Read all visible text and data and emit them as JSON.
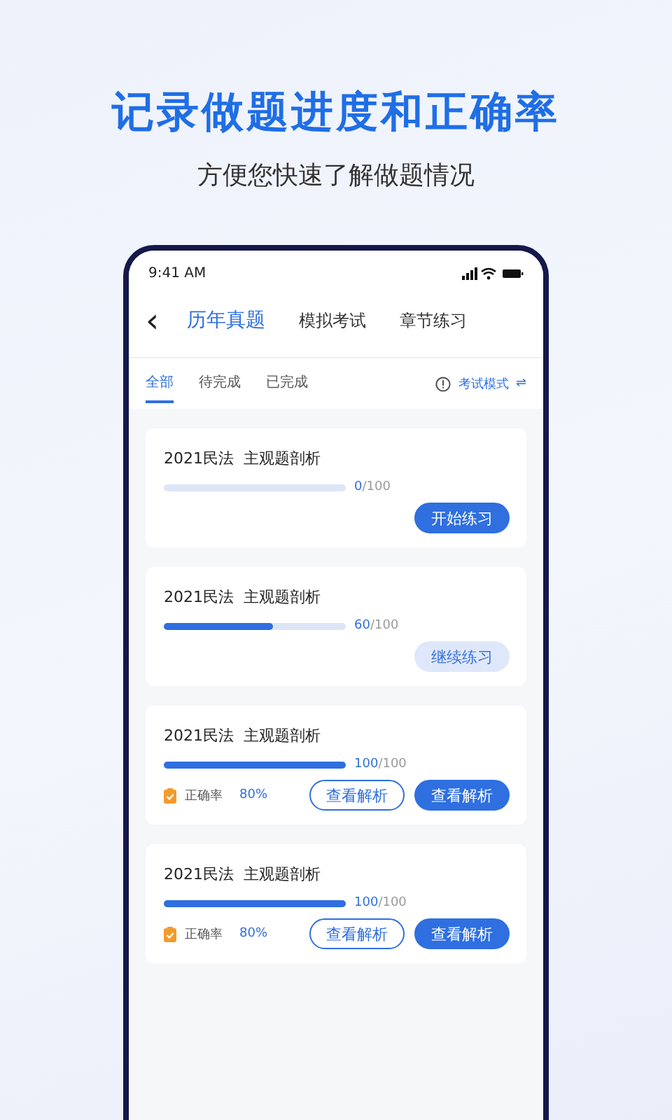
{
  "headline": "记录做题进度和正确率",
  "subtitle": "方便您快速了解做题情况",
  "status_bar": {
    "time": "9:41 AM"
  },
  "nav": {
    "back": "‹",
    "tabs": [
      {
        "label": "历年真题",
        "selected": true
      },
      {
        "label": "模拟考试",
        "selected": false
      },
      {
        "label": "章节练习",
        "selected": false
      }
    ]
  },
  "filters": [
    {
      "label": "全部",
      "selected": true
    },
    {
      "label": "待完成",
      "selected": false
    },
    {
      "label": "已完成",
      "selected": false
    }
  ],
  "mode": {
    "label": "考试模式",
    "switch": "⇌"
  },
  "cards": [
    {
      "title": "2021民法  主观题剖析",
      "level": 0,
      "done": "0",
      "total": "/100",
      "buttons": [
        {
          "label": "开始练习",
          "kind": "solid"
        }
      ]
    },
    {
      "title": "2021民法  主观题剖析",
      "level": 0.6,
      "done": "60",
      "total": "/100",
      "buttons": [
        {
          "label": "继续练习",
          "kind": "soft"
        }
      ]
    },
    {
      "title": "2021民法  主观题剖析",
      "level": 1,
      "done": "100",
      "total": "/100",
      "accuracy": {
        "label": "正确率",
        "value": "80%"
      },
      "buttons": [
        {
          "label": "查看解析",
          "kind": "outline"
        },
        {
          "label": "查看解析",
          "kind": "solid"
        }
      ]
    },
    {
      "title": "2021民法  主观题剖析",
      "level": 1,
      "done": "100",
      "total": "/100",
      "accuracy": {
        "label": "正确率",
        "value": "80%"
      },
      "buttons": [
        {
          "label": "查看解析",
          "kind": "outline"
        },
        {
          "label": "查看解析",
          "kind": "solid"
        }
      ]
    }
  ]
}
